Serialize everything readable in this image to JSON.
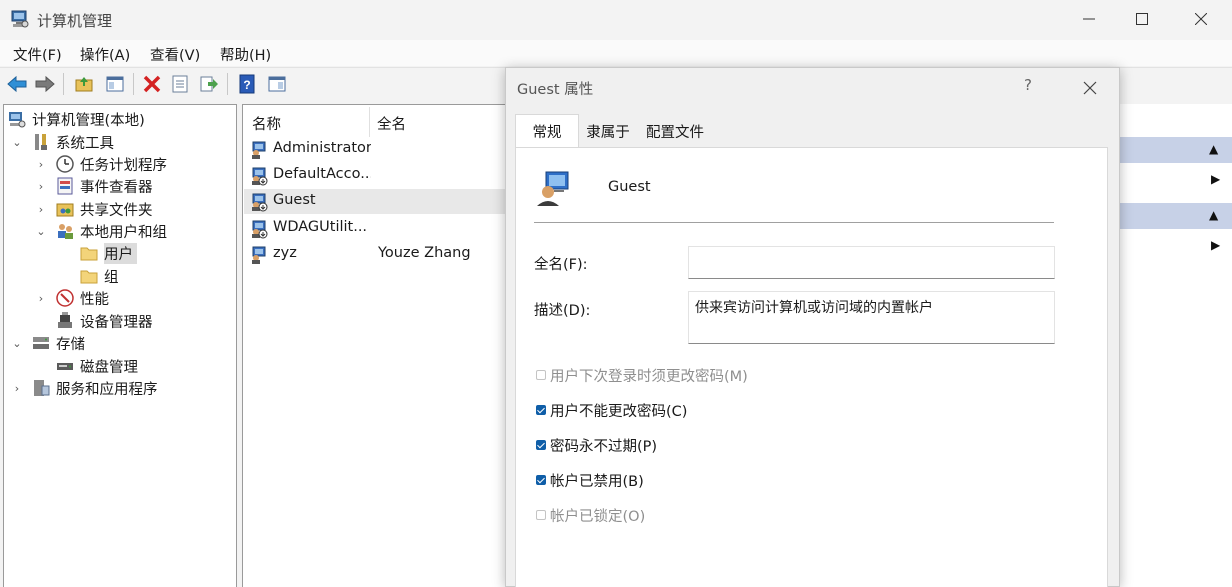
{
  "window": {
    "title": "计算机管理",
    "icon": "computer-management-icon"
  },
  "menu": [
    "文件(F)",
    "操作(A)",
    "查看(V)",
    "帮助(H)"
  ],
  "tree": {
    "root": "计算机管理(本地)",
    "system_tools": "系统工具",
    "task_scheduler": "任务计划程序",
    "event_viewer": "事件查看器",
    "shared_folders": "共享文件夹",
    "local_users_groups": "本地用户和组",
    "users": "用户",
    "groups": "组",
    "performance": "性能",
    "device_manager": "设备管理器",
    "storage": "存储",
    "disk_management": "磁盘管理",
    "services_apps": "服务和应用程序"
  },
  "list": {
    "headers": [
      "名称",
      "全名"
    ],
    "rows": [
      {
        "name": "Administrator",
        "full": ""
      },
      {
        "name": "DefaultAcco...",
        "full": ""
      },
      {
        "name": "Guest",
        "full": ""
      },
      {
        "name": "WDAGUtilit...",
        "full": ""
      },
      {
        "name": "zyz",
        "full": "Youze Zhang"
      }
    ],
    "selected_row": "Guest"
  },
  "dialog": {
    "title": "Guest 属性",
    "help": "?",
    "tabs": [
      "常规",
      "隶属于",
      "配置文件"
    ],
    "active_tab": "常规",
    "user_name": "Guest",
    "fullname_label": "全名(F):",
    "fullname_value": "",
    "description_label": "描述(D):",
    "description_value": "供来宾访问计算机或访问域的内置帐户",
    "options": [
      {
        "label": "用户下次登录时须更改密码(M)",
        "checked": false,
        "enabled": false
      },
      {
        "label": "用户不能更改密码(C)",
        "checked": true,
        "enabled": true
      },
      {
        "label": "密码永不过期(P)",
        "checked": true,
        "enabled": true
      },
      {
        "label": "帐户已禁用(B)",
        "checked": true,
        "enabled": true
      },
      {
        "label": "帐户已锁定(O)",
        "checked": false,
        "enabled": false
      }
    ]
  },
  "colors": {
    "selection": "#dcdcdc",
    "action_header": "#c7d1e7",
    "checkbox_accent": "#0f5ea8"
  }
}
